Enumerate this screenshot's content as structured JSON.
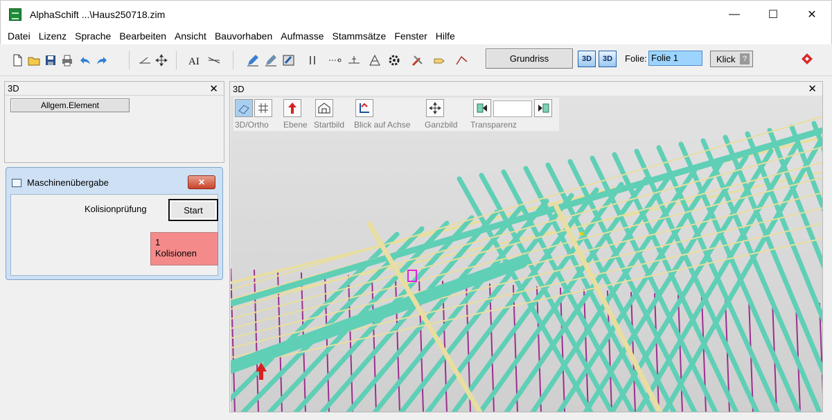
{
  "window": {
    "title": "AlphaSchift ...\\Haus250718.zim",
    "minimize": "—",
    "maximize": "☐",
    "close": "✕"
  },
  "menu": [
    "Datei",
    "Lizenz",
    "Sprache",
    "Bearbeiten",
    "Ansicht",
    "Bauvorhaben",
    "Aufmasse",
    "Stammsätze",
    "Fenster",
    "Hilfe"
  ],
  "toolbar": {
    "grundriss_label": "Grundriss",
    "btn3d_a": "3D",
    "btn3d_b": "3D",
    "folie_label": "Folie:",
    "folie_value": "Folie 1",
    "klick_label": "Klick",
    "klick_help": "?"
  },
  "left_pane": {
    "title": "3D",
    "close": "✕",
    "allgem_button": "Allgem.Element"
  },
  "dialog": {
    "title": "Maschinenübergabe",
    "close": "✕",
    "kolision_label": "Kolisionprüfung",
    "start_button": "Start",
    "result_count": "1",
    "result_label": "Kolisionen",
    "result_color": "#f58a8a"
  },
  "view3d": {
    "title": "3D",
    "close": "✕",
    "tools": {
      "ortho": "3D/Ortho",
      "ebene": "Ebene",
      "startbild": "Startbild",
      "blick": "Blick auf Achse",
      "ganzbild": "Ganzbild",
      "transparenz": "Transparenz"
    },
    "colors": {
      "rafter": "#5fcfb6",
      "batten": "#e8dea0",
      "wall": "#9a2f8e"
    }
  }
}
